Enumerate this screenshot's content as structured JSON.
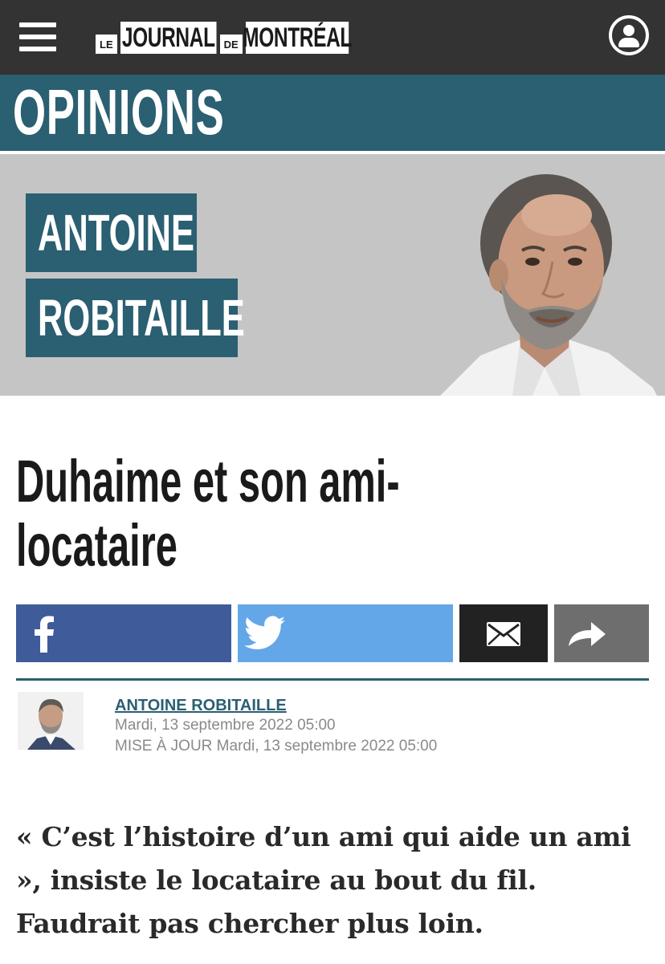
{
  "header": {
    "logo": {
      "le": "LE",
      "journal": "JOURNAL",
      "de": "DE",
      "montreal": "MONTRÉAL"
    }
  },
  "section": {
    "title": "OPINIONS"
  },
  "author_banner": {
    "first_name": "ANTOINE",
    "last_name": "ROBITAILLE"
  },
  "article": {
    "headline_line1": "Duhaime et son ami-",
    "headline_line2": "locataire",
    "byline": {
      "author": "ANTOINE ROBITAILLE",
      "published": "Mardi, 13 septembre 2022 05:00",
      "updated": "MISE À JOUR Mardi, 13 septembre 2022 05:00"
    },
    "lead": "« C’est l’histoire d’un ami qui aide un ami », insiste le locataire au bout du fil. Faudrait pas chercher plus loin."
  },
  "share": {
    "icons": [
      "facebook-icon",
      "twitter-icon",
      "email-icon",
      "share-arrow-icon"
    ]
  },
  "colors": {
    "topbar": "#333333",
    "brand_teal": "#2b5f72",
    "facebook": "#3f5b99",
    "twitter": "#64a7e8",
    "email": "#222222",
    "more": "#6e6e6e",
    "banner_bg": "#c5c5c5"
  }
}
